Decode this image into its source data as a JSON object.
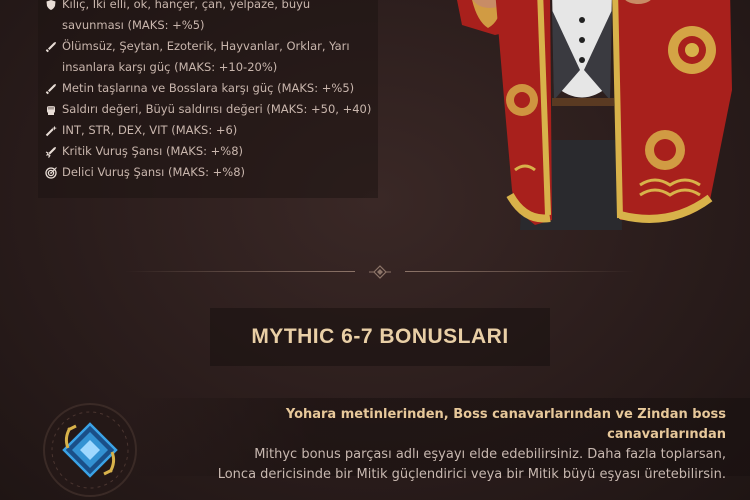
{
  "bonuses": [
    {
      "icon": "shield-icon",
      "text": "Kılıç, İki elli, ok, hançer, çan, yelpaze, büyü"
    },
    {
      "icon": "",
      "text": "savunması (MAKS: +%5)"
    },
    {
      "icon": "sword-icon",
      "text": "Ölümsüz, Şeytan, Ezoterik, Hayvanlar, Orklar, Yarı"
    },
    {
      "icon": "",
      "text": "insanlara karşı güç (MAKS: +10-20%)"
    },
    {
      "icon": "sword-icon",
      "text": "Metin taşlarına ve Bosslara karşı güç (MAKS: +%5)"
    },
    {
      "icon": "fist-icon",
      "text": "Saldırı değeri, Büyü saldırısı değeri (MAKS: +50, +40)"
    },
    {
      "icon": "wand-icon",
      "text": "INT, STR, DEX, VIT (MAKS: +6)"
    },
    {
      "icon": "critical-strike-icon",
      "text": "Kritik Vuruş Şansı (MAKS: +%8)"
    },
    {
      "icon": "target-icon",
      "text": "Delici Vuruş Şansı (MAKS: +%8)"
    }
  ],
  "section": {
    "title": "MYTHIC 6-7 BONUSLARI"
  },
  "description": {
    "lead": "Yohara metinlerinden, Boss canavarlarından ve Zindan boss canavarlarından",
    "line2": "Mithyc bonus parçası adlı eşyayı elde edebilirsiniz. Daha fazla toplarsan,",
    "line3": "Lonca dericisinde bir Mitik güçlendirici veya bir Mitik büyü eşyası üretebilirsin."
  },
  "colors": {
    "background": "#2b1d1c",
    "title": "#e9cfa6",
    "lead_text": "#e7c89a",
    "body_text": "#c8b8b0",
    "robe_red": "#a8201c",
    "robe_gold": "#d8b24a",
    "icon_blue": "#3aa2e6"
  }
}
